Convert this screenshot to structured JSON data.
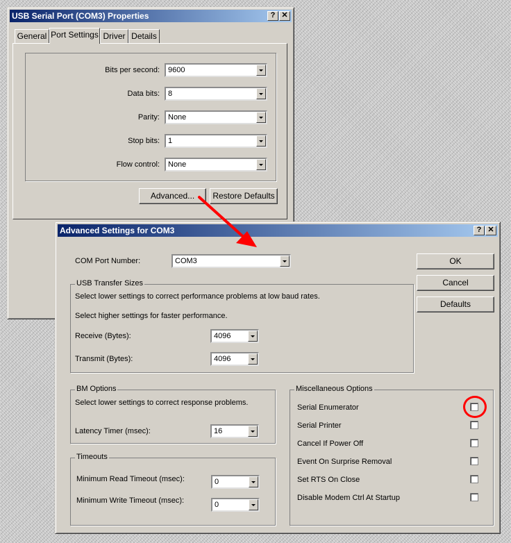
{
  "props_window": {
    "title": "USB Serial Port (COM3) Properties",
    "tabs": [
      {
        "label": "General"
      },
      {
        "label": "Port Settings"
      },
      {
        "label": "Driver"
      },
      {
        "label": "Details"
      }
    ],
    "fields": [
      {
        "label": "Bits per second:",
        "value": "9600"
      },
      {
        "label": "Data bits:",
        "value": "8"
      },
      {
        "label": "Parity:",
        "value": "None"
      },
      {
        "label": "Stop bits:",
        "value": "1"
      },
      {
        "label": "Flow control:",
        "value": "None"
      }
    ],
    "advanced_label": "Advanced...",
    "restore_label": "Restore Defaults"
  },
  "adv_window": {
    "title": "Advanced Settings for COM3",
    "com_port_label": "COM Port Number:",
    "com_port_value": "COM3",
    "ok_label": "OK",
    "cancel_label": "Cancel",
    "defaults_label": "Defaults",
    "usb": {
      "title": "USB Transfer Sizes",
      "line1": "Select lower settings to correct performance problems at low baud rates.",
      "line2": "Select higher settings for faster performance.",
      "receive_label": "Receive (Bytes):",
      "receive_value": "4096",
      "transmit_label": "Transmit (Bytes):",
      "transmit_value": "4096"
    },
    "bm": {
      "title": "BM Options",
      "line": "Select lower settings to correct response problems.",
      "latency_label": "Latency Timer (msec):",
      "latency_value": "16"
    },
    "timeouts": {
      "title": "Timeouts",
      "read_label": "Minimum Read Timeout (msec):",
      "read_value": "0",
      "write_label": "Minimum Write Timeout (msec):",
      "write_value": "0"
    },
    "misc": {
      "title": "Miscellaneous Options",
      "options": [
        {
          "label": "Serial Enumerator",
          "checked": false
        },
        {
          "label": "Serial Printer",
          "checked": false
        },
        {
          "label": "Cancel If Power Off",
          "checked": false
        },
        {
          "label": "Event On Surprise Removal",
          "checked": false
        },
        {
          "label": "Set RTS On Close",
          "checked": false
        },
        {
          "label": "Disable Modem Ctrl At Startup",
          "checked": false
        }
      ]
    }
  },
  "colors": {
    "face": "#d4d0c8",
    "title_start": "#0a246a",
    "title_end": "#a6caf0",
    "annotation": "#ff0000"
  }
}
